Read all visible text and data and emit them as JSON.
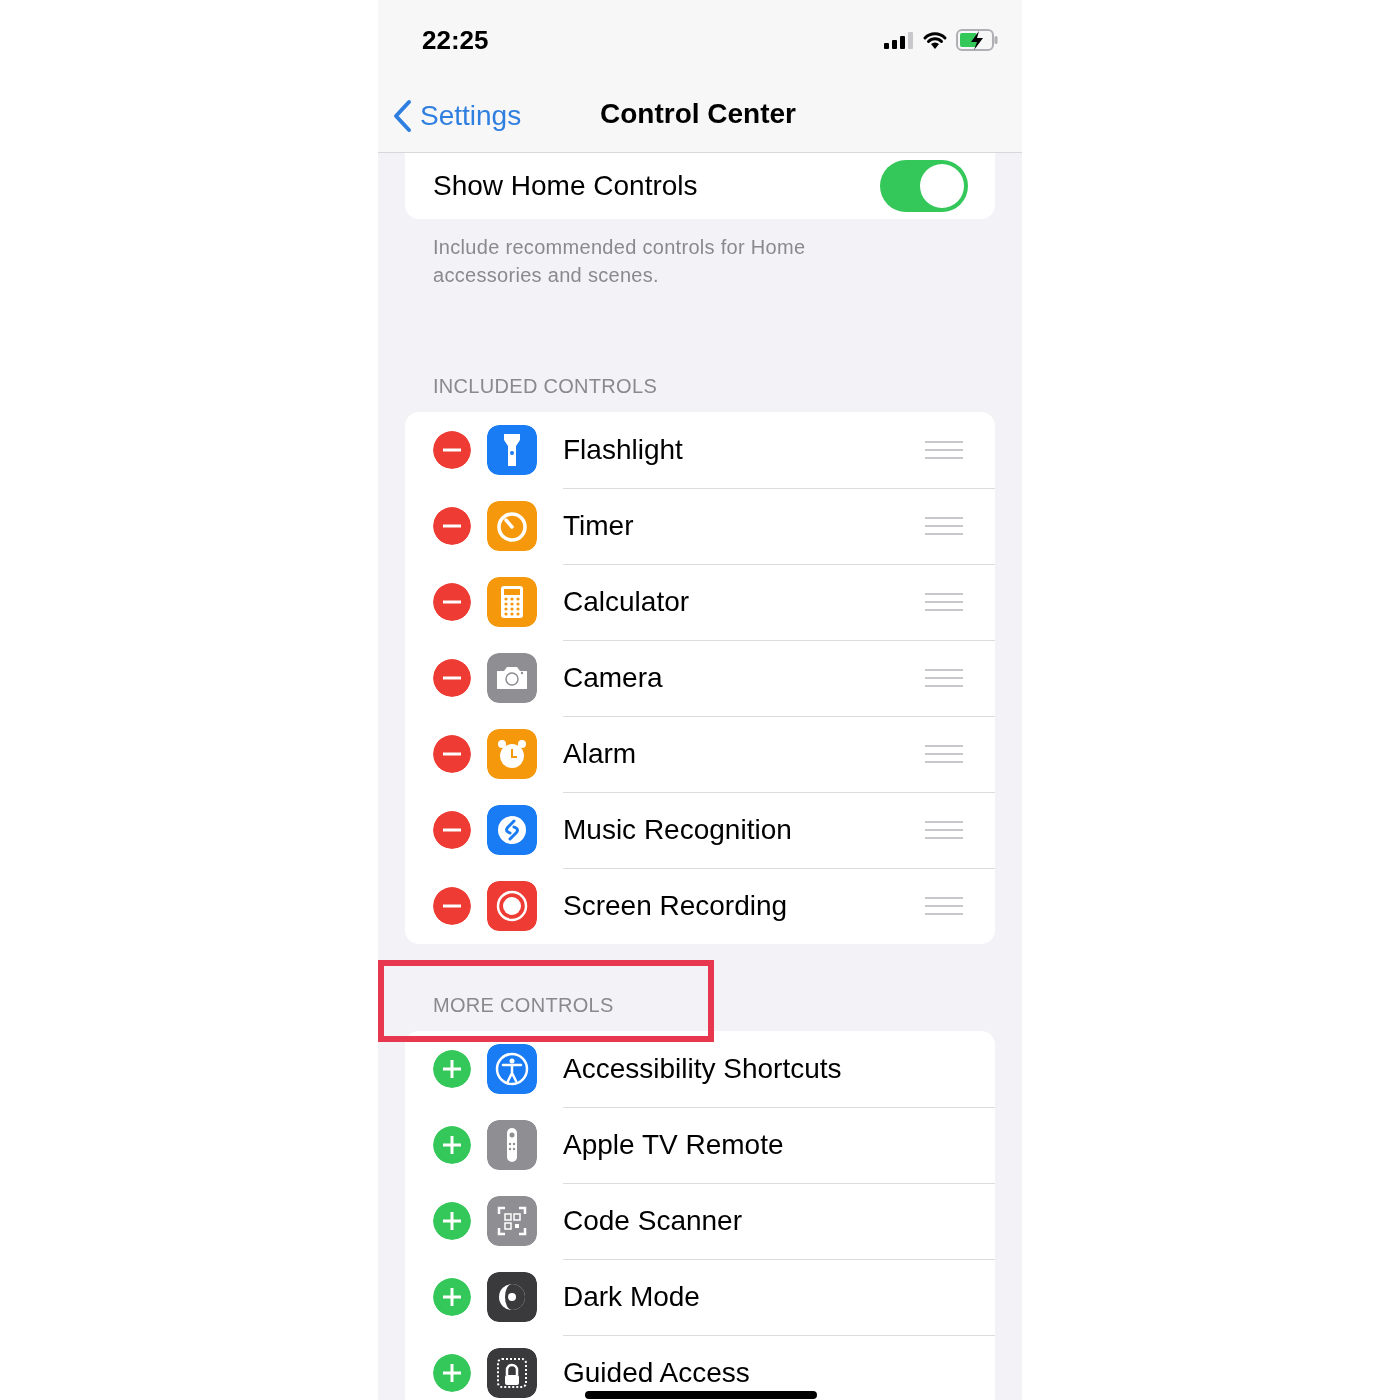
{
  "status_bar": {
    "time": "22:25"
  },
  "nav": {
    "back": "Settings",
    "title": "Control Center"
  },
  "home_controls": {
    "label": "Show Home Controls",
    "on": true,
    "footer": "Include recommended controls for Home accessories and scenes."
  },
  "sections": [
    {
      "header": "INCLUDED CONTROLS",
      "highlighted": false,
      "rows": [
        {
          "label": "Flashlight",
          "kind": "remove"
        },
        {
          "label": "Timer",
          "kind": "remove"
        },
        {
          "label": "Calculator",
          "kind": "remove"
        },
        {
          "label": "Camera",
          "kind": "remove"
        },
        {
          "label": "Alarm",
          "kind": "remove"
        },
        {
          "label": "Music Recognition",
          "kind": "remove"
        },
        {
          "label": "Screen Recording",
          "kind": "remove"
        }
      ]
    },
    {
      "header": "MORE CONTROLS",
      "highlighted": true,
      "rows": [
        {
          "label": "Accessibility Shortcuts",
          "kind": "add"
        },
        {
          "label": "Apple TV Remote",
          "kind": "add"
        },
        {
          "label": "Code Scanner",
          "kind": "add"
        },
        {
          "label": "Dark Mode",
          "kind": "add"
        },
        {
          "label": "Guided Access",
          "kind": "add"
        }
      ]
    }
  ]
}
